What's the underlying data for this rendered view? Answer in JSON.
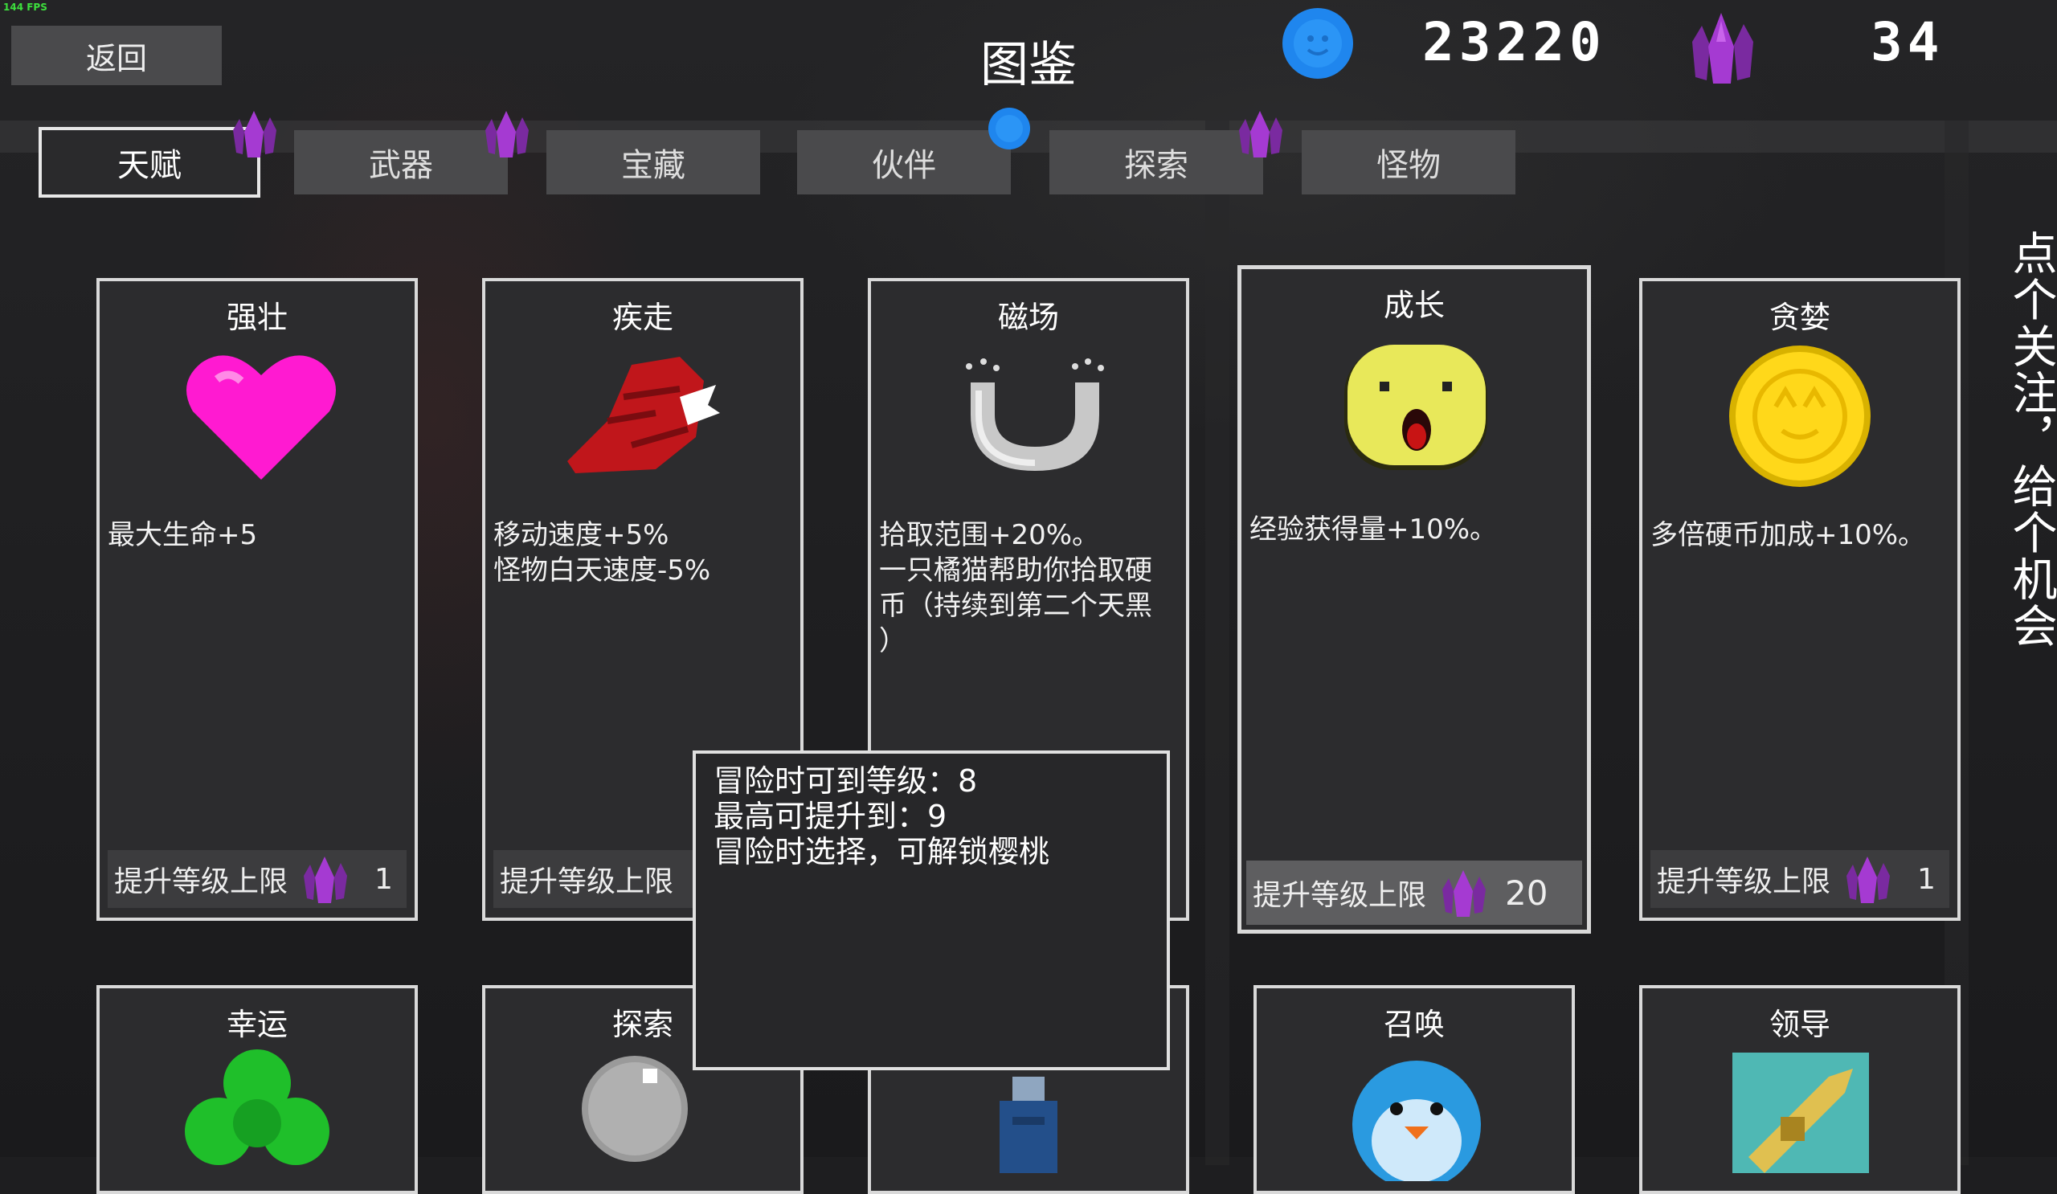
{
  "fps": "144 FPS",
  "header": {
    "back_label": "返回",
    "title": "图鉴",
    "coins": "23220",
    "gems": "34"
  },
  "tabs": [
    {
      "label": "天赋",
      "active": true
    },
    {
      "label": "武器",
      "active": false
    },
    {
      "label": "宝藏",
      "active": false
    },
    {
      "label": "伙伴",
      "active": false
    },
    {
      "label": "探索",
      "active": false
    },
    {
      "label": "怪物",
      "active": false
    }
  ],
  "cards": [
    {
      "title": "强壮",
      "icon": "heart-icon",
      "desc": "最大生命+5",
      "foot_label": "提升等级上限",
      "cost": "1"
    },
    {
      "title": "疾走",
      "icon": "winged-boot-icon",
      "desc": "移动速度+5%\n怪物白天速度-5%",
      "foot_label": "提升等级上限",
      "cost": ""
    },
    {
      "title": "磁场",
      "icon": "magnet-icon",
      "desc": "拾取范围+20%。\n一只橘猫帮助你拾取硬\n币（持续到第二个天黑\n）",
      "foot_label": "",
      "cost": ""
    },
    {
      "title": "成长",
      "icon": "yellow-face-icon",
      "desc": "经验获得量+10%。",
      "foot_label": "提升等级上限",
      "cost": "20"
    },
    {
      "title": "贪婪",
      "icon": "gold-coin-icon",
      "desc": "多倍硬币加成+10%。",
      "foot_label": "提升等级上限",
      "cost": "1"
    }
  ],
  "row2": [
    {
      "title": "幸运",
      "icon": "clover-icon"
    },
    {
      "title": "探索",
      "icon": "pin-icon"
    },
    {
      "title": "",
      "icon": "blue-figure-icon"
    },
    {
      "title": "召唤",
      "icon": "penguin-icon"
    },
    {
      "title": "领导",
      "icon": "trumpet-icon"
    }
  ],
  "tooltip": {
    "line1": "冒险时可到等级：8",
    "line2": "最高可提升到：9",
    "line3": "冒险时选择，可解锁樱桃"
  },
  "side_text": "点个关注，给个机会",
  "colors": {
    "gem": "#8e2fb8",
    "coin": "#2a8ff0",
    "panel": "#2c2c2e",
    "tab": "#4a4a4c"
  }
}
